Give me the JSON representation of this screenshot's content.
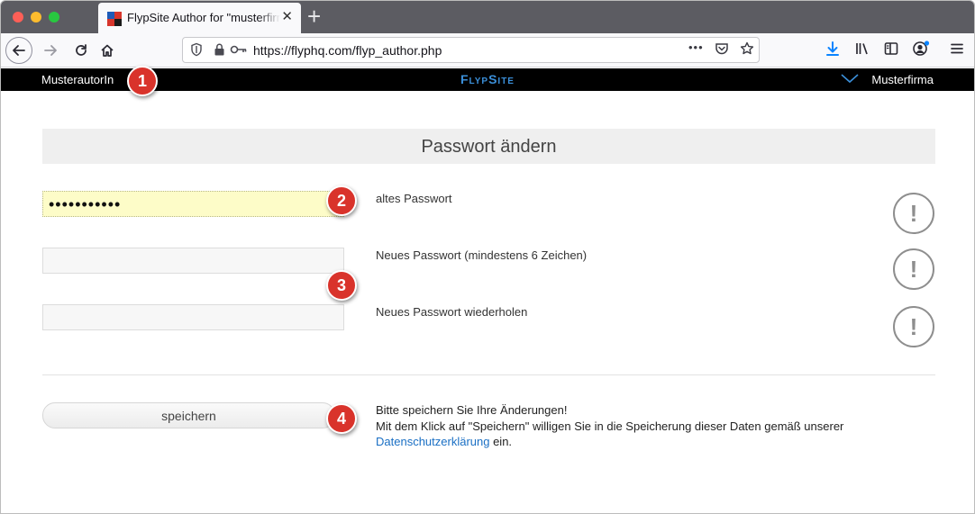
{
  "browser": {
    "tab_title": "FlypSite Author for \"musterfirma\"",
    "tab_close": "✕",
    "new_tab": "+",
    "url": "https://flyphq.com/flyp_author.php",
    "url_more": "•••"
  },
  "header": {
    "user": "MusterautorIn",
    "brand": "FlypSite",
    "company": "Musterfirma"
  },
  "page": {
    "title": "Passwort ändern"
  },
  "form": {
    "old_password": {
      "value": "•••••••••••",
      "label": "altes Passwort"
    },
    "new_password": {
      "value": "",
      "label": "Neues Passwort (mindestens 6 Zeichen)"
    },
    "repeat_password": {
      "value": "",
      "label": "Neues Passwort wiederholen"
    },
    "warning_symbol": "!",
    "save_label": "speichern",
    "notice_line1": "Bitte speichern Sie Ihre Änderungen!",
    "notice_line2": "Mit dem Klick auf \"Speichern\" willigen Sie in die Speicherung dieser Daten gemäß unserer",
    "privacy_link": "Datenschutzerklärung",
    "notice_line3_suffix": " ein."
  },
  "badges": [
    "1",
    "2",
    "3",
    "4"
  ],
  "colors": {
    "brand_blue": "#3b8fd9",
    "badge_red": "#d9332b",
    "autofill_yellow": "#fdfcc8"
  }
}
